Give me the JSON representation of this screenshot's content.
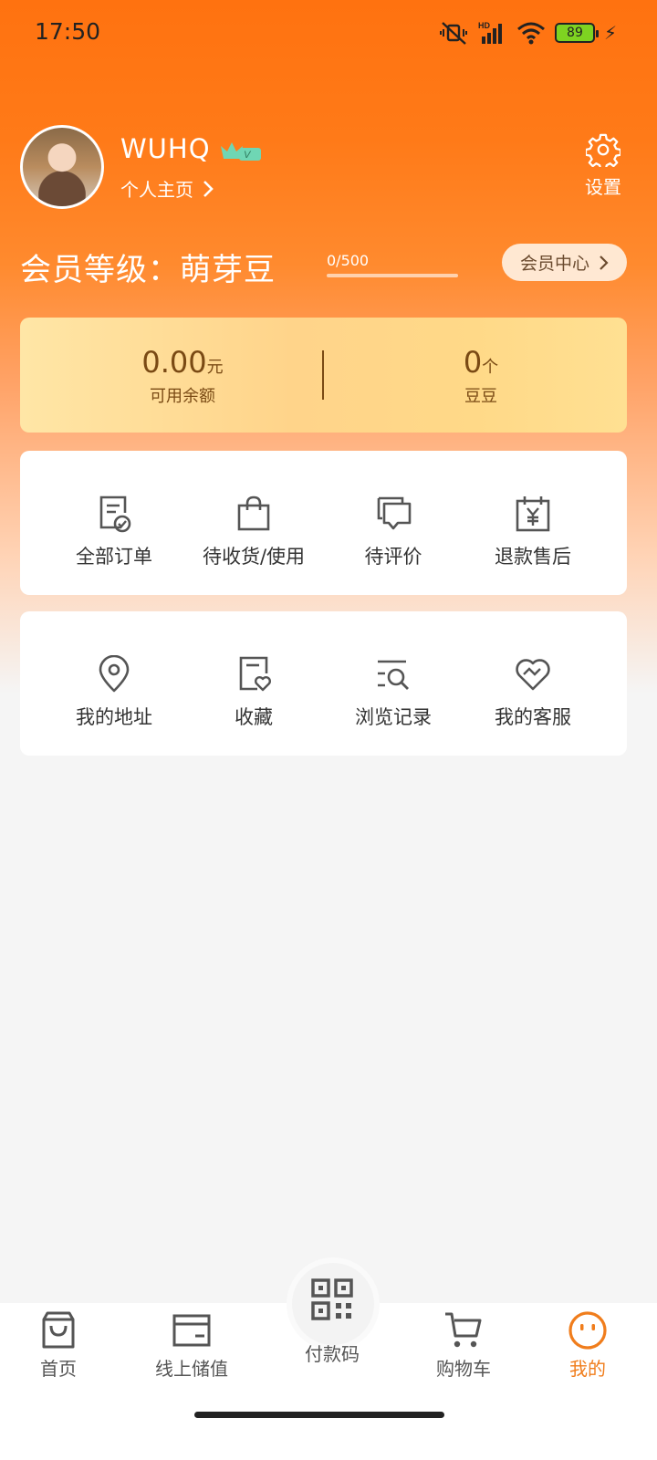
{
  "status": {
    "time": "17:50",
    "battery": "89",
    "icons": [
      "mute-vibrate-icon",
      "hd-signal-icon",
      "wifi-icon",
      "battery-icon",
      "charging-icon"
    ]
  },
  "profile": {
    "username": "WUHQ",
    "badge": "V",
    "homepage_label": "个人主页",
    "settings_label": "设置"
  },
  "member": {
    "level_label": "会员等级：萌芽豆",
    "progress_text": "0/500",
    "progress_value": 0,
    "progress_max": 500,
    "center_label": "会员中心"
  },
  "balance": {
    "amount": "0.00",
    "amount_unit": "元",
    "amount_label": "可用余额",
    "beans": "0",
    "beans_unit": "个",
    "beans_label": "豆豆"
  },
  "orders": [
    {
      "label": "全部订单",
      "icon": "order-list-icon"
    },
    {
      "label": "待收货/使用",
      "icon": "shopping-bag-icon"
    },
    {
      "label": "待评价",
      "icon": "comment-icon"
    },
    {
      "label": "退款售后",
      "icon": "refund-icon"
    }
  ],
  "services": [
    {
      "label": "我的地址",
      "icon": "location-pin-icon"
    },
    {
      "label": "收藏",
      "icon": "favorite-icon"
    },
    {
      "label": "浏览记录",
      "icon": "browse-history-icon"
    },
    {
      "label": "我的客服",
      "icon": "customer-service-icon"
    }
  ],
  "nav": {
    "home": "首页",
    "recharge": "线上储值",
    "pay": "付款码",
    "cart": "购物车",
    "mine": "我的"
  },
  "colors": {
    "brand": "#ff7210",
    "active_tab": "#f07d1c",
    "card_gold": "#ffd48a"
  }
}
